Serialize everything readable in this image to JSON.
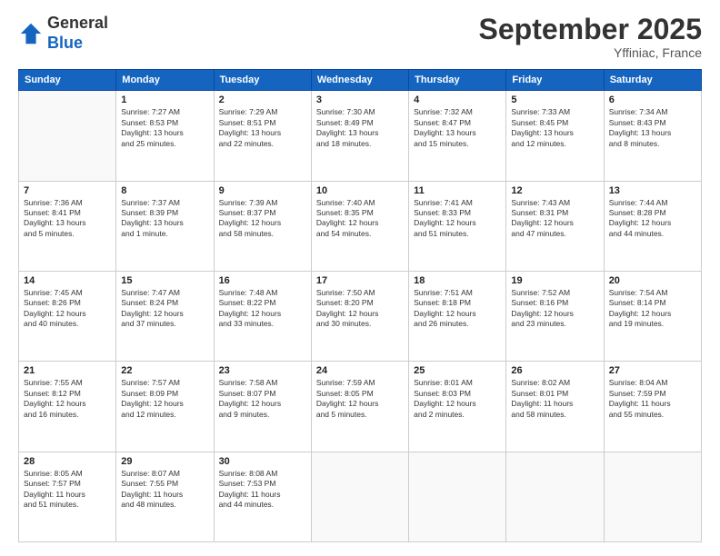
{
  "logo": {
    "general": "General",
    "blue": "Blue"
  },
  "header": {
    "month": "September 2025",
    "location": "Yffiniac, France"
  },
  "weekdays": [
    "Sunday",
    "Monday",
    "Tuesday",
    "Wednesday",
    "Thursday",
    "Friday",
    "Saturday"
  ],
  "weeks": [
    [
      {
        "day": "",
        "info": ""
      },
      {
        "day": "1",
        "info": "Sunrise: 7:27 AM\nSunset: 8:53 PM\nDaylight: 13 hours\nand 25 minutes."
      },
      {
        "day": "2",
        "info": "Sunrise: 7:29 AM\nSunset: 8:51 PM\nDaylight: 13 hours\nand 22 minutes."
      },
      {
        "day": "3",
        "info": "Sunrise: 7:30 AM\nSunset: 8:49 PM\nDaylight: 13 hours\nand 18 minutes."
      },
      {
        "day": "4",
        "info": "Sunrise: 7:32 AM\nSunset: 8:47 PM\nDaylight: 13 hours\nand 15 minutes."
      },
      {
        "day": "5",
        "info": "Sunrise: 7:33 AM\nSunset: 8:45 PM\nDaylight: 13 hours\nand 12 minutes."
      },
      {
        "day": "6",
        "info": "Sunrise: 7:34 AM\nSunset: 8:43 PM\nDaylight: 13 hours\nand 8 minutes."
      }
    ],
    [
      {
        "day": "7",
        "info": "Sunrise: 7:36 AM\nSunset: 8:41 PM\nDaylight: 13 hours\nand 5 minutes."
      },
      {
        "day": "8",
        "info": "Sunrise: 7:37 AM\nSunset: 8:39 PM\nDaylight: 13 hours\nand 1 minute."
      },
      {
        "day": "9",
        "info": "Sunrise: 7:39 AM\nSunset: 8:37 PM\nDaylight: 12 hours\nand 58 minutes."
      },
      {
        "day": "10",
        "info": "Sunrise: 7:40 AM\nSunset: 8:35 PM\nDaylight: 12 hours\nand 54 minutes."
      },
      {
        "day": "11",
        "info": "Sunrise: 7:41 AM\nSunset: 8:33 PM\nDaylight: 12 hours\nand 51 minutes."
      },
      {
        "day": "12",
        "info": "Sunrise: 7:43 AM\nSunset: 8:31 PM\nDaylight: 12 hours\nand 47 minutes."
      },
      {
        "day": "13",
        "info": "Sunrise: 7:44 AM\nSunset: 8:28 PM\nDaylight: 12 hours\nand 44 minutes."
      }
    ],
    [
      {
        "day": "14",
        "info": "Sunrise: 7:45 AM\nSunset: 8:26 PM\nDaylight: 12 hours\nand 40 minutes."
      },
      {
        "day": "15",
        "info": "Sunrise: 7:47 AM\nSunset: 8:24 PM\nDaylight: 12 hours\nand 37 minutes."
      },
      {
        "day": "16",
        "info": "Sunrise: 7:48 AM\nSunset: 8:22 PM\nDaylight: 12 hours\nand 33 minutes."
      },
      {
        "day": "17",
        "info": "Sunrise: 7:50 AM\nSunset: 8:20 PM\nDaylight: 12 hours\nand 30 minutes."
      },
      {
        "day": "18",
        "info": "Sunrise: 7:51 AM\nSunset: 8:18 PM\nDaylight: 12 hours\nand 26 minutes."
      },
      {
        "day": "19",
        "info": "Sunrise: 7:52 AM\nSunset: 8:16 PM\nDaylight: 12 hours\nand 23 minutes."
      },
      {
        "day": "20",
        "info": "Sunrise: 7:54 AM\nSunset: 8:14 PM\nDaylight: 12 hours\nand 19 minutes."
      }
    ],
    [
      {
        "day": "21",
        "info": "Sunrise: 7:55 AM\nSunset: 8:12 PM\nDaylight: 12 hours\nand 16 minutes."
      },
      {
        "day": "22",
        "info": "Sunrise: 7:57 AM\nSunset: 8:09 PM\nDaylight: 12 hours\nand 12 minutes."
      },
      {
        "day": "23",
        "info": "Sunrise: 7:58 AM\nSunset: 8:07 PM\nDaylight: 12 hours\nand 9 minutes."
      },
      {
        "day": "24",
        "info": "Sunrise: 7:59 AM\nSunset: 8:05 PM\nDaylight: 12 hours\nand 5 minutes."
      },
      {
        "day": "25",
        "info": "Sunrise: 8:01 AM\nSunset: 8:03 PM\nDaylight: 12 hours\nand 2 minutes."
      },
      {
        "day": "26",
        "info": "Sunrise: 8:02 AM\nSunset: 8:01 PM\nDaylight: 11 hours\nand 58 minutes."
      },
      {
        "day": "27",
        "info": "Sunrise: 8:04 AM\nSunset: 7:59 PM\nDaylight: 11 hours\nand 55 minutes."
      }
    ],
    [
      {
        "day": "28",
        "info": "Sunrise: 8:05 AM\nSunset: 7:57 PM\nDaylight: 11 hours\nand 51 minutes."
      },
      {
        "day": "29",
        "info": "Sunrise: 8:07 AM\nSunset: 7:55 PM\nDaylight: 11 hours\nand 48 minutes."
      },
      {
        "day": "30",
        "info": "Sunrise: 8:08 AM\nSunset: 7:53 PM\nDaylight: 11 hours\nand 44 minutes."
      },
      {
        "day": "",
        "info": ""
      },
      {
        "day": "",
        "info": ""
      },
      {
        "day": "",
        "info": ""
      },
      {
        "day": "",
        "info": ""
      }
    ]
  ]
}
